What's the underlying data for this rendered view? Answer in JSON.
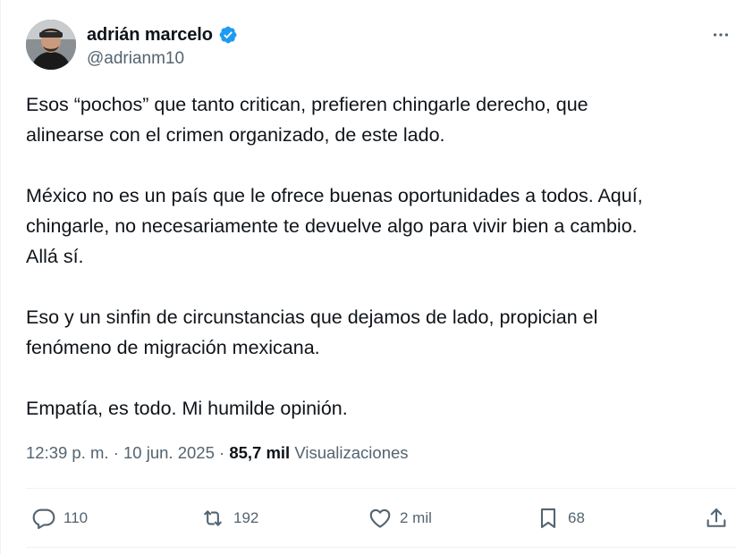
{
  "author": {
    "display_name": "adrián marcelo",
    "handle": "@adrianm10",
    "verified": true,
    "verified_color": "#1d9bf0"
  },
  "more_icon": "more-horizontal-icon",
  "tweet": {
    "paragraphs": [
      "Esos “pochos” que tanto critican, prefieren chingarle derecho, que\nalinearse con el crimen organizado, de este lado.",
      "México no es un país que le ofrece buenas oportunidades a todos. Aquí,\nchingarle, no necesariamente te devuelve algo para vivir bien a cambio.\nAllá sí.",
      "Eso y un sinfin de circunstancias que dejamos de lado, propician el\nfenómeno de migración mexicana.",
      "Empatía, es todo. Mi humilde opinión."
    ]
  },
  "meta": {
    "time": "12:39 p. m.",
    "separator": " · ",
    "date": "10 jun. 2025",
    "views_count": "85,7 mil",
    "views_label": " Visualizaciones"
  },
  "actions": {
    "replies": {
      "icon": "reply-icon",
      "count": "110"
    },
    "reposts": {
      "icon": "repost-icon",
      "count": "192"
    },
    "likes": {
      "icon": "heart-icon",
      "count": "2 mil"
    },
    "bookmarks": {
      "icon": "bookmark-icon",
      "count": "68"
    },
    "share": {
      "icon": "share-icon"
    }
  },
  "colors": {
    "text_primary": "#0f1419",
    "text_secondary": "#536471",
    "divider": "#eff3f4"
  }
}
